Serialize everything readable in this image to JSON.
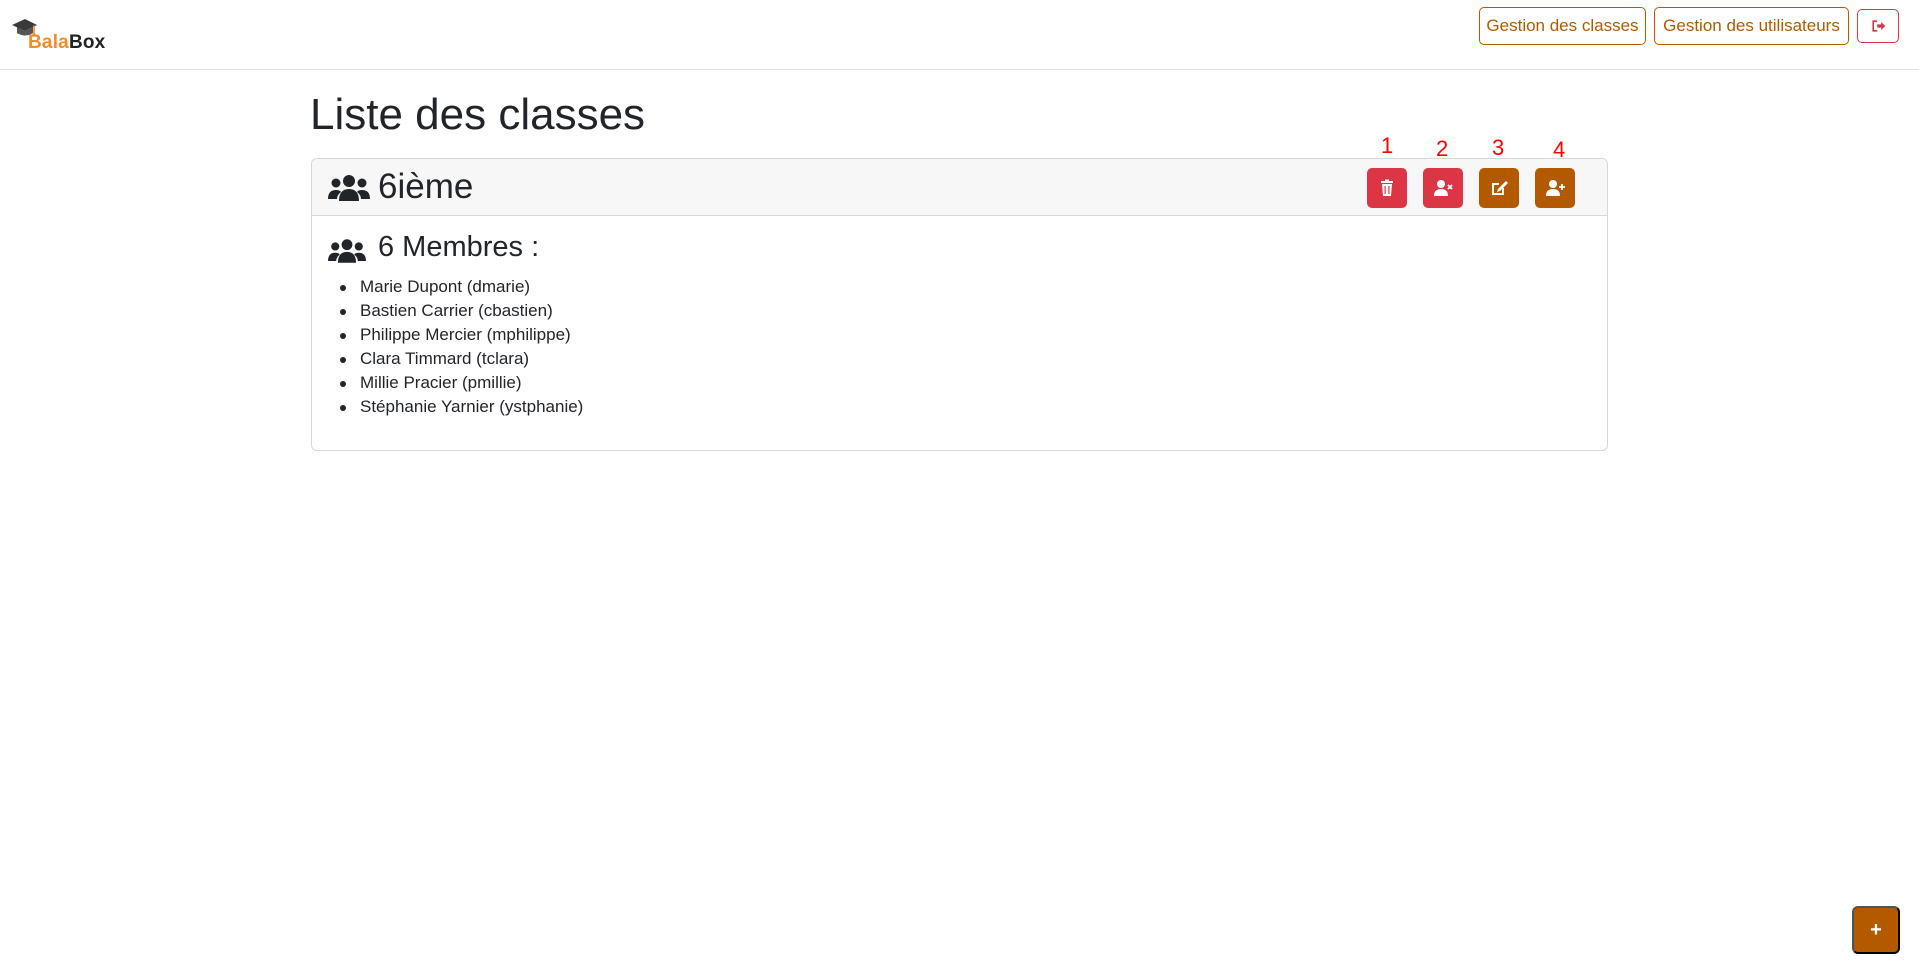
{
  "app": {
    "brand_first": "Bala",
    "brand_second": "Box"
  },
  "navbar": {
    "classes_label": "Gestion des classes",
    "users_label": "Gestion des utilisateurs",
    "logout_icon": "sign-out-icon"
  },
  "page": {
    "title": "Liste des classes"
  },
  "class_card": {
    "name": "6ième",
    "actions": [
      {
        "number": "1",
        "icon": "trash-icon",
        "color": "#dc3545"
      },
      {
        "number": "2",
        "icon": "user-remove-icon",
        "color": "#dc3545"
      },
      {
        "number": "3",
        "icon": "edit-icon",
        "color": "#b35a00"
      },
      {
        "number": "4",
        "icon": "user-add-icon",
        "color": "#b35a00"
      }
    ],
    "members_title": "6 Membres :",
    "members": [
      "Marie Dupont (dmarie)",
      "Bastien Carrier (cbastien)",
      "Philippe Mercier (mphilippe)",
      "Clara Timmard (tclara)",
      "Millie Pracier (pmillie)",
      "Stéphanie Yarnier (ystphanie)"
    ]
  },
  "fab": {
    "label": "+"
  },
  "colors": {
    "accent": "#b35a00",
    "danger": "#dc3545",
    "brand_orange": "#f28c28"
  }
}
